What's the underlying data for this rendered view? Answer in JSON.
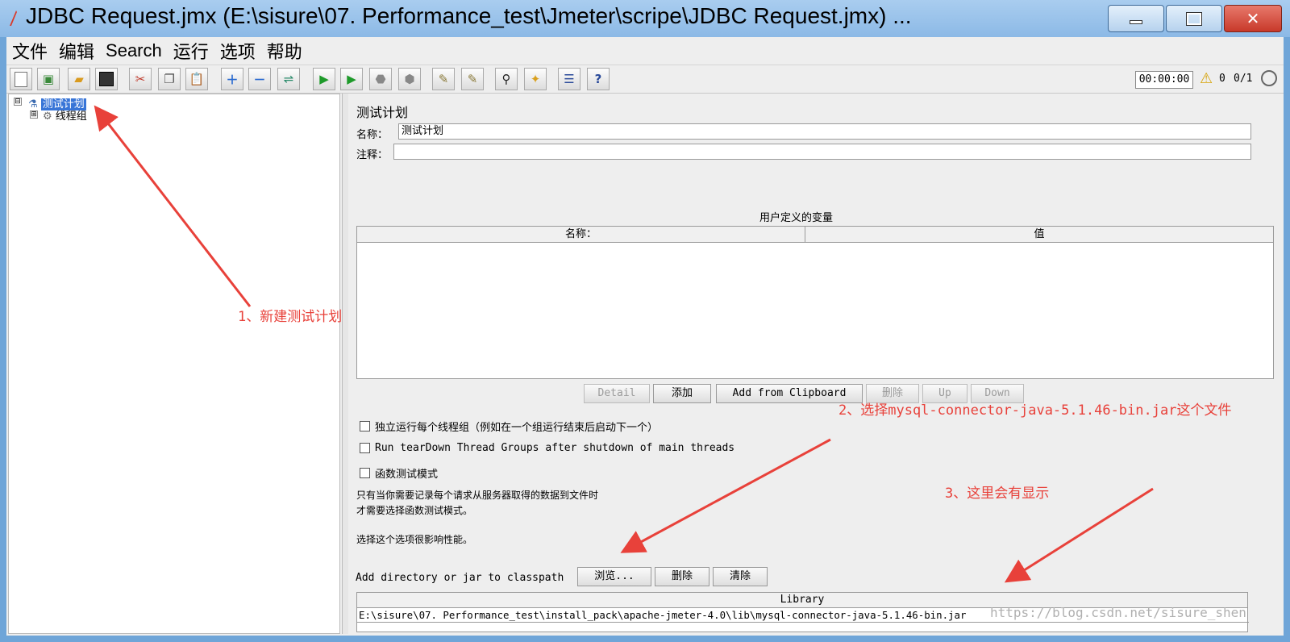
{
  "window": {
    "title": "JDBC Request.jmx (E:\\sisure\\07. Performance_test\\Jmeter\\scripe\\JDBC Request.jmx) ...",
    "minimize_icon": "minimize-icon",
    "maximize_icon": "maximize-icon",
    "close_icon": "close-icon"
  },
  "menu": {
    "items": [
      "文件",
      "编辑",
      "Search",
      "运行",
      "选项",
      "帮助"
    ]
  },
  "toolbar": {
    "icons": [
      "new-icon",
      "templates-icon",
      "open-icon",
      "save-icon",
      "cut-icon",
      "copy-icon",
      "paste-icon",
      "expand-icon",
      "collapse-icon",
      "toggle-icon",
      "start-icon",
      "start-no-pause-icon",
      "stop-icon",
      "shutdown-icon",
      "clear-icon",
      "clear-all-icon",
      "search-icon",
      "reset-search-icon",
      "function-helper-icon",
      "help-icon"
    ],
    "timer": "00:00:00",
    "error_count": "0",
    "thread_count": "0/1"
  },
  "tree": {
    "root_label": "测试计划",
    "child_label": "线程组",
    "expander_root": "⊟",
    "expander_child": "⊞"
  },
  "plan": {
    "section_title": "测试计划",
    "name_label": "名称：",
    "name_value": "测试计划",
    "comment_label": "注释：",
    "comment_value": "",
    "vars_title": "用户定义的变量",
    "col_name": "名称：",
    "col_value": "值",
    "buttons": {
      "detail": "Detail",
      "add": "添加",
      "add_clipboard": "Add from Clipboard",
      "delete": "删除",
      "up": "Up",
      "down": "Down"
    },
    "check_serialize": "独立运行每个线程组（例如在一个组运行结束后启动下一个）",
    "check_teardown": "Run tearDown Thread Groups after shutdown of main threads",
    "check_functional": "函数测试模式",
    "note_line1": "只有当你需要记录每个请求从服务器取得的数据到文件时",
    "note_line2": "才需要选择函数测试模式。",
    "note_line3": "选择这个选项很影响性能。",
    "classpath_label": "Add directory or jar to classpath",
    "browse_button": "浏览...",
    "cp_delete_button": "删除",
    "cp_clear_button": "清除",
    "library_header": "Library",
    "library_row": "E:\\sisure\\07. Performance_test\\install_pack\\apache-jmeter-4.0\\lib\\mysql-connector-java-5.1.46-bin.jar"
  },
  "annotations": {
    "a1": "1、新建测试计划",
    "a2": "2、选择mysql-connector-java-5.1.46-bin.jar这个文件",
    "a3": "3、这里会有显示",
    "color": "#e8413a"
  },
  "watermark": "https://blog.csdn.net/sisure_shen"
}
